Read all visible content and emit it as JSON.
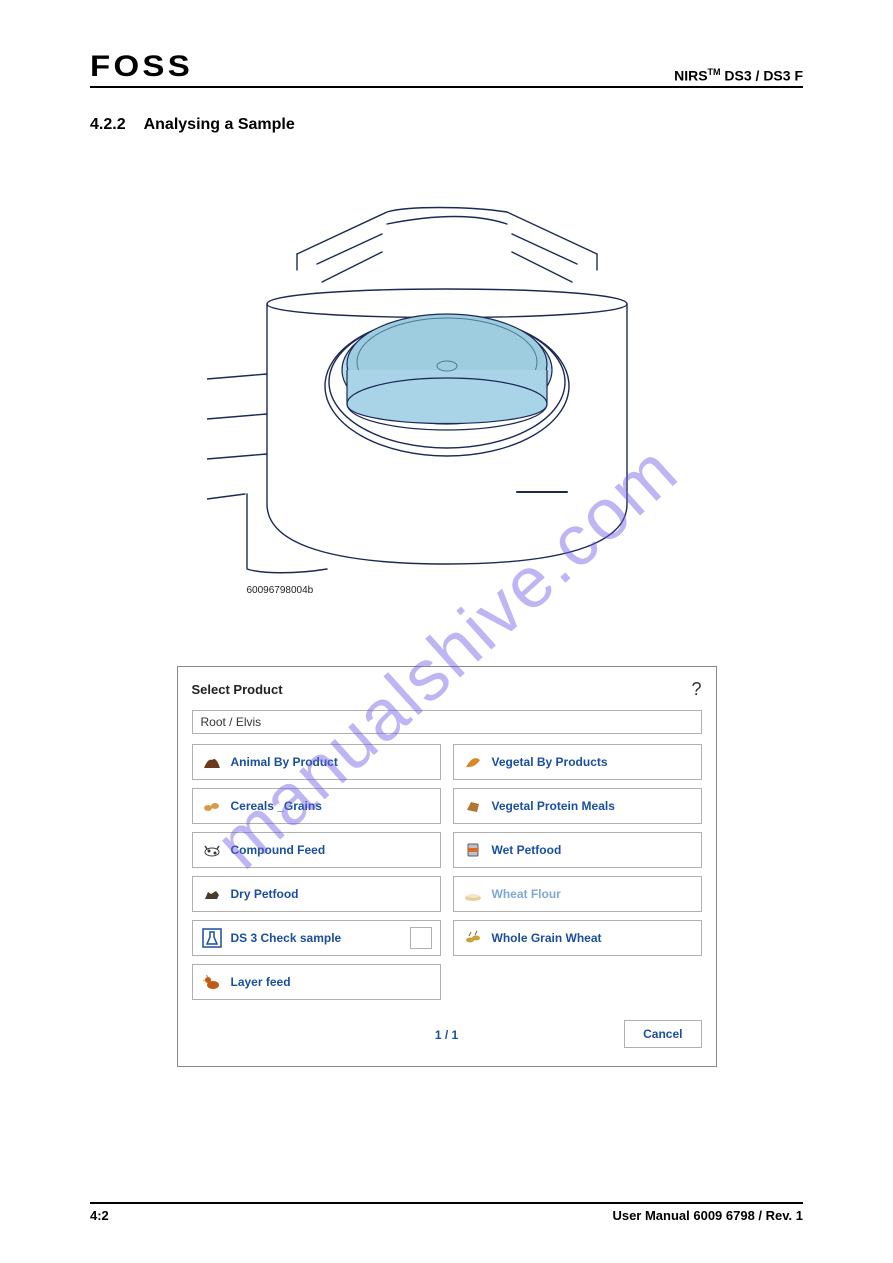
{
  "header": {
    "logo": "FOSS",
    "product": "NIRS",
    "trademark": "TM",
    "model": " DS3 / DS3 F"
  },
  "section": {
    "number": "4.2.2",
    "title": "Analysing a Sample"
  },
  "figure": {
    "id": "60096798004b"
  },
  "panel": {
    "title": "Select Product",
    "help": "?",
    "breadcrumb": "Root / Elvis",
    "products": [
      {
        "label": "Animal By Product",
        "icon": "pile-brown",
        "muted": false,
        "aux": false
      },
      {
        "label": "Vegetal By Products",
        "icon": "leaf-orange",
        "muted": false,
        "aux": false
      },
      {
        "label": "Cereals _Grains",
        "icon": "grain-orange",
        "muted": false,
        "aux": false
      },
      {
        "label": "Vegetal Protein Meals",
        "icon": "chunk-brown",
        "muted": false,
        "aux": false
      },
      {
        "label": "Compound Feed",
        "icon": "cow",
        "muted": false,
        "aux": false
      },
      {
        "label": "Wet Petfood",
        "icon": "can",
        "muted": false,
        "aux": false
      },
      {
        "label": "Dry Petfood",
        "icon": "dog",
        "muted": false,
        "aux": false
      },
      {
        "label": "Wheat Flour",
        "icon": "flour",
        "muted": true,
        "aux": false
      },
      {
        "label": "DS 3 Check sample",
        "icon": "flask-box",
        "muted": false,
        "aux": true
      },
      {
        "label": "Whole Grain Wheat",
        "icon": "wheat",
        "muted": false,
        "aux": false
      },
      {
        "label": "Layer feed",
        "icon": "chicken",
        "muted": false,
        "aux": false
      }
    ],
    "pager": "1 / 1",
    "cancel": "Cancel"
  },
  "footer": {
    "page": "4:2",
    "manual": "User Manual 6009 6798 / Rev. 1"
  },
  "watermark": "manualshive.com",
  "icons": {
    "pile-brown": "#6b3a1a",
    "leaf-orange": "#d8872a",
    "grain-orange": "#d89b4a",
    "chunk-brown": "#b0752e",
    "cow": "#3a3a3a",
    "can": "#5a5a6a",
    "dog": "#4a3a2a",
    "flour": "#e6cf9a",
    "flask-box": "#1a4fa0",
    "wheat": "#caa23a",
    "chicken": "#c25a1a"
  }
}
